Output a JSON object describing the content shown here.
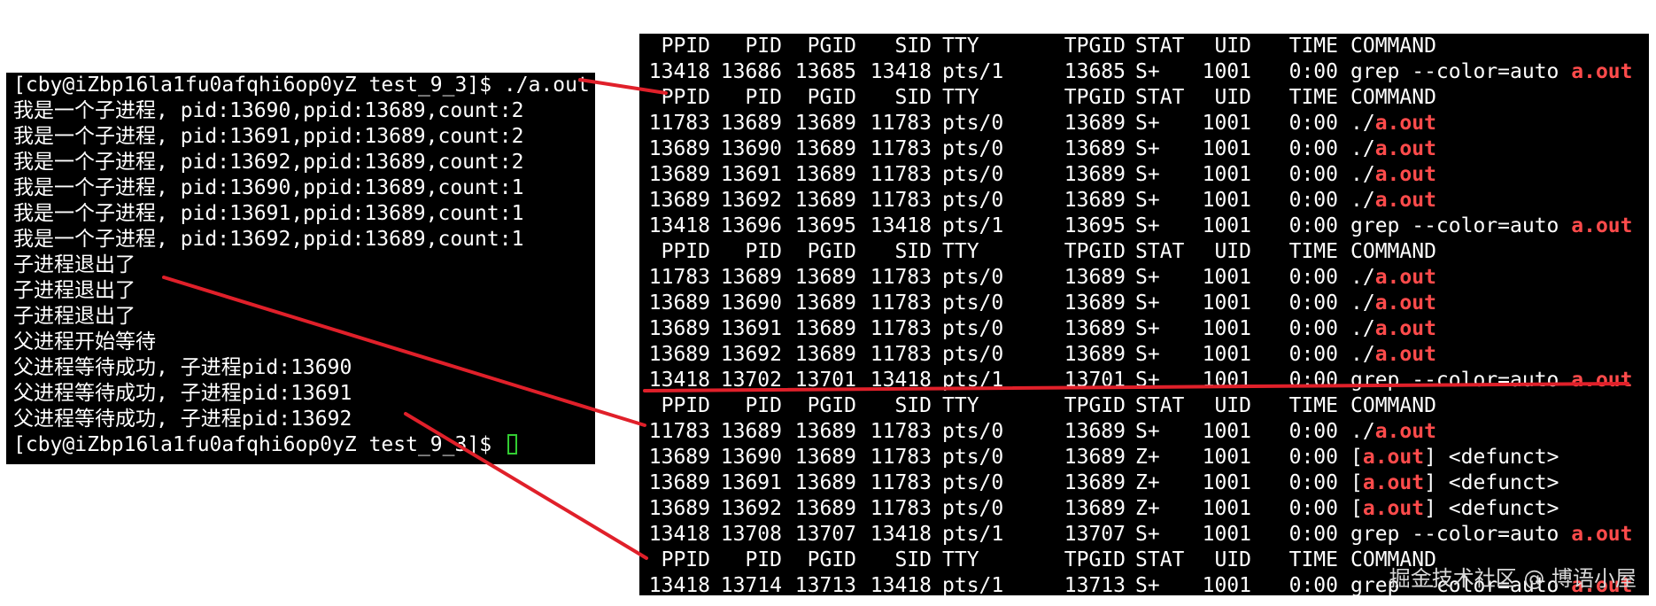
{
  "left_terminal": {
    "lines": [
      "[cby@iZbp16la1fu0afqhi6op0yZ test_9_3]$ ./a.out",
      "我是一个子进程, pid:13690,ppid:13689,count:2",
      "我是一个子进程, pid:13691,ppid:13689,count:2",
      "我是一个子进程, pid:13692,ppid:13689,count:2",
      "我是一个子进程, pid:13690,ppid:13689,count:1",
      "我是一个子进程, pid:13691,ppid:13689,count:1",
      "我是一个子进程, pid:13692,ppid:13689,count:1",
      "子进程退出了",
      "子进程退出了",
      "子进程退出了",
      "父进程开始等待",
      "父进程等待成功, 子进程pid:13690",
      "父进程等待成功, 子进程pid:13691",
      "父进程等待成功, 子进程pid:13692"
    ],
    "prompt": "[cby@iZbp16la1fu0afqhi6op0yZ test_9_3]$ "
  },
  "right_terminal": {
    "headers": [
      "PPID",
      "PID",
      "PGID",
      "SID",
      "TTY",
      "TPGID",
      "STAT",
      "UID",
      "TIME",
      "COMMAND"
    ],
    "rows": [
      {
        "type": "header"
      },
      {
        "type": "data",
        "v": [
          "13418",
          "13686",
          "13685",
          "13418",
          "pts/1",
          "13685",
          "S+",
          "1001",
          "0:00"
        ],
        "cmd_pre": "grep --color=auto ",
        "cmd_hl": "a.out",
        "cmd_post": ""
      },
      {
        "type": "header"
      },
      {
        "type": "data",
        "v": [
          "11783",
          "13689",
          "13689",
          "11783",
          "pts/0",
          "13689",
          "S+",
          "1001",
          "0:00"
        ],
        "cmd_pre": "./",
        "cmd_hl": "a.out",
        "cmd_post": ""
      },
      {
        "type": "data",
        "v": [
          "13689",
          "13690",
          "13689",
          "11783",
          "pts/0",
          "13689",
          "S+",
          "1001",
          "0:00"
        ],
        "cmd_pre": "./",
        "cmd_hl": "a.out",
        "cmd_post": ""
      },
      {
        "type": "data",
        "v": [
          "13689",
          "13691",
          "13689",
          "11783",
          "pts/0",
          "13689",
          "S+",
          "1001",
          "0:00"
        ],
        "cmd_pre": "./",
        "cmd_hl": "a.out",
        "cmd_post": ""
      },
      {
        "type": "data",
        "v": [
          "13689",
          "13692",
          "13689",
          "11783",
          "pts/0",
          "13689",
          "S+",
          "1001",
          "0:00"
        ],
        "cmd_pre": "./",
        "cmd_hl": "a.out",
        "cmd_post": ""
      },
      {
        "type": "data",
        "v": [
          "13418",
          "13696",
          "13695",
          "13418",
          "pts/1",
          "13695",
          "S+",
          "1001",
          "0:00"
        ],
        "cmd_pre": "grep --color=auto ",
        "cmd_hl": "a.out",
        "cmd_post": ""
      },
      {
        "type": "header"
      },
      {
        "type": "data",
        "v": [
          "11783",
          "13689",
          "13689",
          "11783",
          "pts/0",
          "13689",
          "S+",
          "1001",
          "0:00"
        ],
        "cmd_pre": "./",
        "cmd_hl": "a.out",
        "cmd_post": ""
      },
      {
        "type": "data",
        "v": [
          "13689",
          "13690",
          "13689",
          "11783",
          "pts/0",
          "13689",
          "S+",
          "1001",
          "0:00"
        ],
        "cmd_pre": "./",
        "cmd_hl": "a.out",
        "cmd_post": ""
      },
      {
        "type": "data",
        "v": [
          "13689",
          "13691",
          "13689",
          "11783",
          "pts/0",
          "13689",
          "S+",
          "1001",
          "0:00"
        ],
        "cmd_pre": "./",
        "cmd_hl": "a.out",
        "cmd_post": ""
      },
      {
        "type": "data",
        "v": [
          "13689",
          "13692",
          "13689",
          "11783",
          "pts/0",
          "13689",
          "S+",
          "1001",
          "0:00"
        ],
        "cmd_pre": "./",
        "cmd_hl": "a.out",
        "cmd_post": ""
      },
      {
        "type": "data",
        "v": [
          "13418",
          "13702",
          "13701",
          "13418",
          "pts/1",
          "13701",
          "S+",
          "1001",
          "0:00"
        ],
        "cmd_pre": "grep --color=auto ",
        "cmd_hl": "a.out",
        "cmd_post": ""
      },
      {
        "type": "header"
      },
      {
        "type": "data",
        "v": [
          "11783",
          "13689",
          "13689",
          "11783",
          "pts/0",
          "13689",
          "S+",
          "1001",
          "0:00"
        ],
        "cmd_pre": "./",
        "cmd_hl": "a.out",
        "cmd_post": ""
      },
      {
        "type": "data",
        "v": [
          "13689",
          "13690",
          "13689",
          "11783",
          "pts/0",
          "13689",
          "Z+",
          "1001",
          "0:00"
        ],
        "cmd_pre": "[",
        "cmd_hl": "a.out",
        "cmd_post": "] <defunct>"
      },
      {
        "type": "data",
        "v": [
          "13689",
          "13691",
          "13689",
          "11783",
          "pts/0",
          "13689",
          "Z+",
          "1001",
          "0:00"
        ],
        "cmd_pre": "[",
        "cmd_hl": "a.out",
        "cmd_post": "] <defunct>"
      },
      {
        "type": "data",
        "v": [
          "13689",
          "13692",
          "13689",
          "11783",
          "pts/0",
          "13689",
          "Z+",
          "1001",
          "0:00"
        ],
        "cmd_pre": "[",
        "cmd_hl": "a.out",
        "cmd_post": "] <defunct>"
      },
      {
        "type": "data",
        "v": [
          "13418",
          "13708",
          "13707",
          "13418",
          "pts/1",
          "13707",
          "S+",
          "1001",
          "0:00"
        ],
        "cmd_pre": "grep --color=auto ",
        "cmd_hl": "a.out",
        "cmd_post": ""
      },
      {
        "type": "header"
      },
      {
        "type": "data",
        "v": [
          "13418",
          "13714",
          "13713",
          "13418",
          "pts/1",
          "13713",
          "S+",
          "1001",
          "0:00"
        ],
        "cmd_pre": "grep --color=auto ",
        "cmd_hl": "a.out",
        "cmd_post": ""
      }
    ]
  },
  "watermark": "掘金技术社区 @ 博语小屋",
  "colors": {
    "highlight": "#ff4b4b",
    "annotation": "#e0202a",
    "cursor": "#32cd32"
  }
}
